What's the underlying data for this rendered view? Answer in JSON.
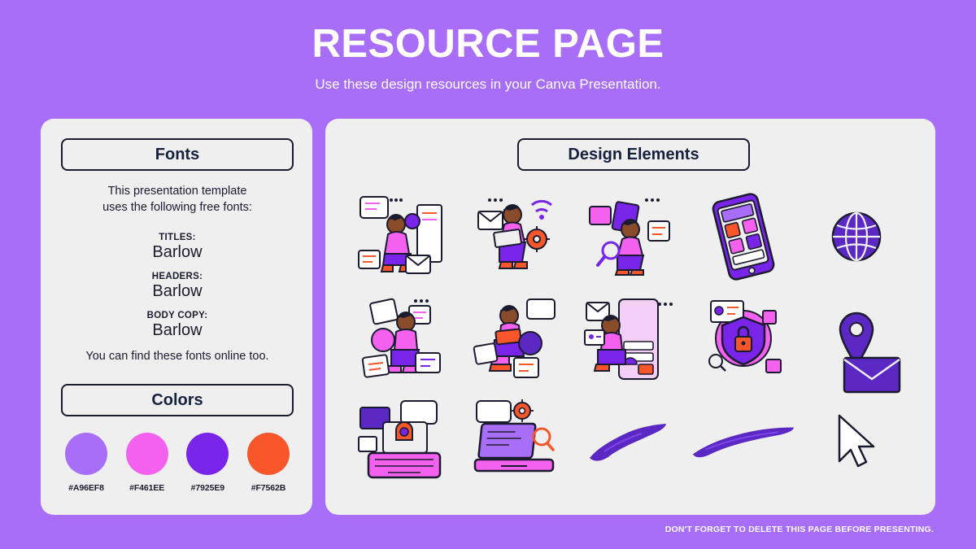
{
  "header": {
    "title": "RESOURCE PAGE",
    "subtitle": "Use these design resources in your Canva Presentation."
  },
  "fonts_panel": {
    "heading": "Fonts",
    "intro_line1": "This presentation template",
    "intro_line2": "uses the following free fonts:",
    "groups": [
      {
        "label": "TITLES:",
        "value": "Barlow"
      },
      {
        "label": "HEADERS:",
        "value": "Barlow"
      },
      {
        "label": "BODY COPY:",
        "value": "Barlow"
      }
    ],
    "outro": "You can find these fonts online too."
  },
  "colors_panel": {
    "heading": "Colors",
    "swatches": [
      {
        "hex": "#A96EF8",
        "label": "#A96EF8"
      },
      {
        "hex": "#F461EE",
        "label": "#F461EE"
      },
      {
        "hex": "#7925E9",
        "label": "#7925E9"
      },
      {
        "hex": "#F7562B",
        "label": "#F7562B"
      }
    ]
  },
  "elements_panel": {
    "heading": "Design Elements",
    "items": [
      {
        "name": "illustration-person-reading-with-mail",
        "row": 1,
        "col": 1
      },
      {
        "name": "illustration-person-laptop-wifi",
        "row": 1,
        "col": 2
      },
      {
        "name": "illustration-person-with-magnifier",
        "row": 1,
        "col": 3
      },
      {
        "name": "illustration-smartphone-app",
        "row": 1,
        "col": 4
      },
      {
        "name": "icon-globe",
        "row": 1,
        "col": 5
      },
      {
        "name": "illustration-person-with-documents",
        "row": 2,
        "col": 1
      },
      {
        "name": "illustration-person-sitting-laptop",
        "row": 2,
        "col": 2
      },
      {
        "name": "illustration-person-chat-screen",
        "row": 2,
        "col": 3
      },
      {
        "name": "illustration-security-lock",
        "row": 2,
        "col": 4
      },
      {
        "name": "icon-location-pin",
        "row": 2,
        "col": 5
      },
      {
        "name": "illustration-desktop-chat",
        "row": 3,
        "col": 1
      },
      {
        "name": "illustration-laptop-search",
        "row": 3,
        "col": 2
      },
      {
        "name": "brush-stroke-small",
        "row": 3,
        "col": 3
      },
      {
        "name": "brush-stroke-large",
        "row": 3,
        "col": 4
      },
      {
        "name": "icon-cursor-arrow",
        "row": 3,
        "col": 5
      },
      {
        "name": "icon-envelope",
        "row": 2,
        "col": 5
      }
    ]
  },
  "footer": {
    "note": "DON'T FORGET TO DELETE THIS PAGE BEFORE PRESENTING."
  },
  "theme": {
    "background": "#A96EF8",
    "panel": "#EFEFEF",
    "ink": "#1b1b2f",
    "purple_deep": "#5B28C4",
    "purple": "#7925E9",
    "pink": "#F461EE",
    "orange": "#F7562B"
  }
}
